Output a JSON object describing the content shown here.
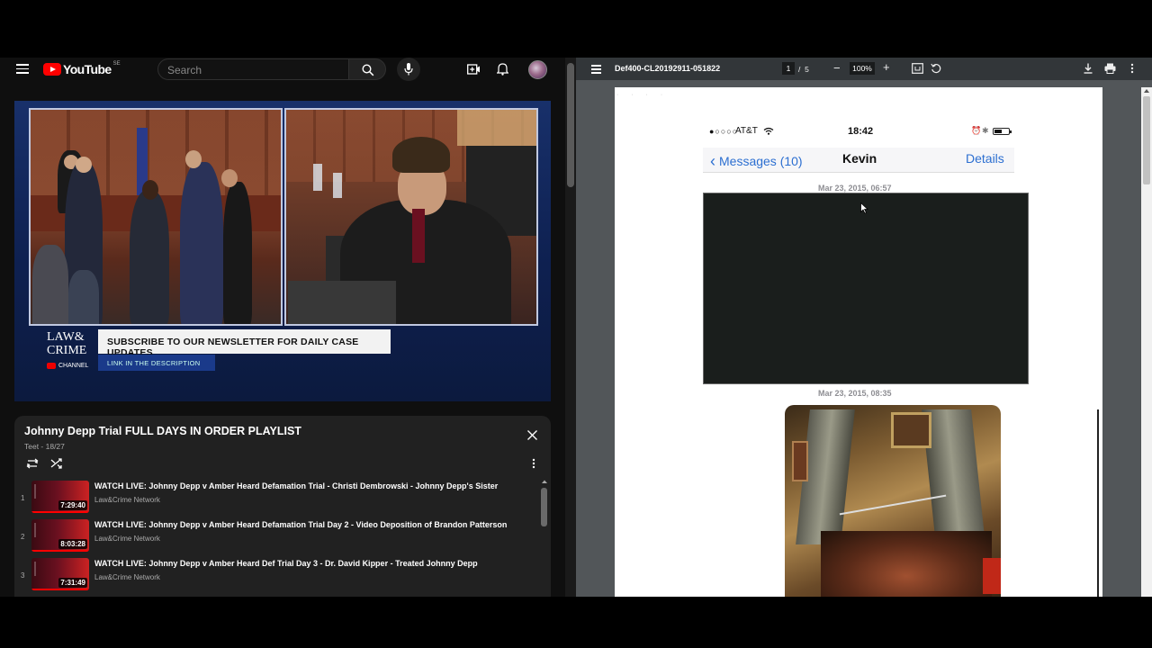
{
  "youtube": {
    "header": {
      "logo_text": "YouTube",
      "country_code": "SE",
      "search_placeholder": "Search",
      "icons": [
        "menu-icon",
        "search-icon",
        "mic-icon",
        "create-icon",
        "bell-icon",
        "avatar"
      ]
    },
    "player": {
      "logo_line1": "LAW&",
      "logo_line2": "CRIME",
      "logo_line3": "CHANNEL",
      "banner_text": "SUBSCRIBE TO OUR NEWSLETTER FOR DAILY CASE UPDATES",
      "link_text": "LINK IN THE DESCRIPTION"
    },
    "playlist": {
      "title": "Johnny Depp Trial FULL DAYS IN ORDER PLAYLIST",
      "subtitle": "Teet - 18/27",
      "items": [
        {
          "index": "1",
          "title": "WATCH LIVE: Johnny Depp v Amber Heard Defamation Trial - Christi Dembrowski - Johnny Depp's Sister",
          "channel": "Law&Crime Network",
          "duration": "7:29:40"
        },
        {
          "index": "2",
          "title": "WATCH LIVE: Johnny Depp v Amber Heard Defamation Trial Day 2 - Video Deposition of Brandon Patterson",
          "channel": "Law&Crime Network",
          "duration": "8:03:28"
        },
        {
          "index": "3",
          "title": "WATCH LIVE: Johnny Depp v Amber Heard Def Trial Day 3 - Dr. David Kipper - Treated Johnny Depp",
          "channel": "Law&Crime Network",
          "duration": "7:31:49"
        }
      ]
    }
  },
  "pdf": {
    "toolbar": {
      "filename": "Def400-CL20192911-051822",
      "current_page": "1",
      "page_sep": "/",
      "total_pages": "5",
      "zoom_minus": "−",
      "zoom": "100%",
      "zoom_plus": "+",
      "icons": [
        "fit-page-icon",
        "rotate-icon",
        "download-icon",
        "print-icon",
        "more-vert-icon"
      ]
    },
    "document": {
      "status_signal": "●○○○○",
      "carrier": "AT&T",
      "time": "18:42",
      "nav_back": "Messages (10)",
      "contact_name": "Kevin",
      "nav_details": "Details",
      "timestamp1": "Mar 23, 2015, 06:57",
      "timestamp2": "Mar 23, 2015, 08:35"
    }
  }
}
